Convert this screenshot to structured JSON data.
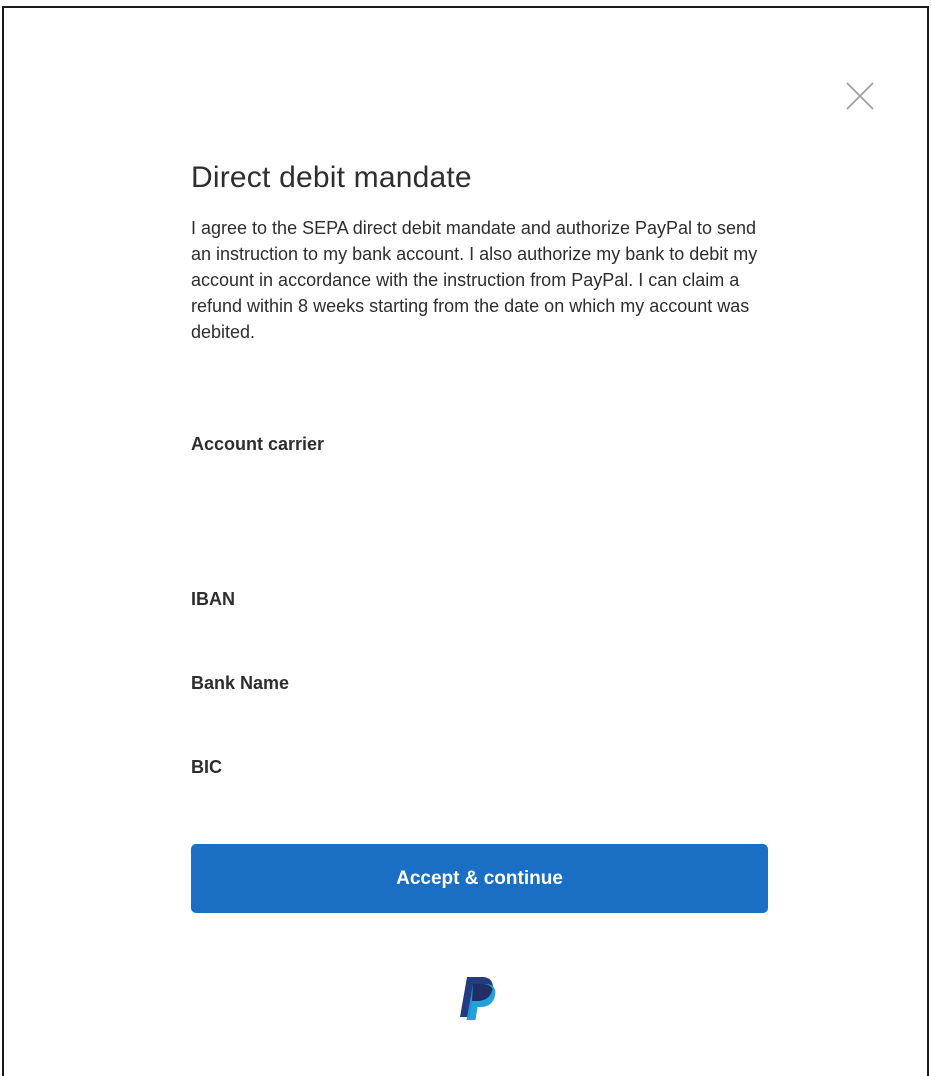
{
  "dialog": {
    "title": "Direct debit mandate",
    "mandate_text": "I agree to the SEPA direct debit mandate and authorize PayPal to send an instruction to my bank account. I also authorize my bank to debit my account in accordance with the instruction from PayPal. I can claim a refund within 8 weeks starting from the date on which my account was debited.",
    "close_icon": "close-icon"
  },
  "fields": {
    "account_carrier_label": "Account carrier",
    "account_carrier_value": "",
    "iban_label": "IBAN",
    "iban_value": "",
    "bank_name_label": "Bank Name",
    "bank_name_value": "",
    "bic_label": "BIC",
    "bic_value": ""
  },
  "actions": {
    "accept_label": "Accept & continue"
  },
  "brand": {
    "logo_icon": "paypal-logo-icon",
    "primary_color": "#1a6ec4",
    "logo_dark_blue": "#253b80",
    "logo_light_blue": "#179bd7"
  }
}
